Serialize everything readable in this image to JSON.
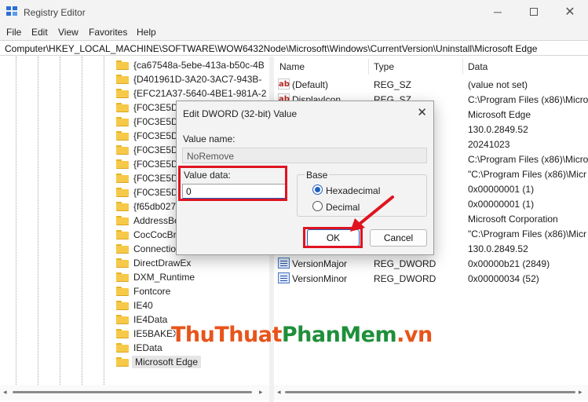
{
  "window": {
    "title": "Registry Editor",
    "minimize_icon": "minimize-icon",
    "maximize_icon": "maximize-icon",
    "close_icon": "close-icon"
  },
  "menu": [
    "File",
    "Edit",
    "View",
    "Favorites",
    "Help"
  ],
  "address": "Computer\\HKEY_LOCAL_MACHINE\\SOFTWARE\\WOW6432Node\\Microsoft\\Windows\\CurrentVersion\\Uninstall\\Microsoft Edge",
  "tree": {
    "items": [
      "{ca67548a-5ebe-413a-b50c-4B",
      "{D401961D-3A20-3AC7-943B-",
      "{EFC21A37-5640-4BE1-981A-2",
      "{F0C3E5D1",
      "{F0C3E5D1",
      "{F0C3E5D1",
      "{F0C3E5D1",
      "{F0C3E5D1",
      "{F0C3E5D1",
      "{F0C3E5D1",
      "{f65db027",
      "AddressBo",
      "CocCocBr",
      "Connection Manager",
      "DirectDrawEx",
      "DXM_Runtime",
      "Fontcore",
      "IE40",
      "IE4Data",
      "IE5BAKEX",
      "IEData",
      "Microsoft Edge"
    ],
    "selected": "Microsoft Edge"
  },
  "list": {
    "columns": [
      "Name",
      "Type",
      "Data"
    ],
    "rows": [
      {
        "name": "(Default)",
        "type": "REG_SZ",
        "data": "(value not set)",
        "icon": "string-value-icon"
      },
      {
        "name": "DisplayIcon",
        "type": "REG_SZ",
        "data": "C:\\Program Files (x86)\\Micro",
        "icon": "string-value-icon"
      },
      {
        "name": "",
        "type": "",
        "data": "Microsoft Edge",
        "icon": ""
      },
      {
        "name": "",
        "type": "",
        "data": "130.0.2849.52",
        "icon": ""
      },
      {
        "name": "",
        "type": "",
        "data": "20241023",
        "icon": ""
      },
      {
        "name": "",
        "type": "",
        "data": "C:\\Program Files (x86)\\Micro",
        "icon": ""
      },
      {
        "name": "",
        "type": "",
        "data": "\"C:\\Program Files (x86)\\Micr",
        "icon": ""
      },
      {
        "name": "",
        "type": "",
        "data": "0x00000001 (1)",
        "icon": ""
      },
      {
        "name": "",
        "type": "",
        "data": "0x00000001 (1)",
        "icon": ""
      },
      {
        "name": "",
        "type": "",
        "data": "Microsoft Corporation",
        "icon": ""
      },
      {
        "name": "",
        "type": "",
        "data": "\"C:\\Program Files (x86)\\Micr",
        "icon": ""
      },
      {
        "name": "",
        "type": "",
        "data": "130.0.2849.52",
        "icon": ""
      },
      {
        "name": "VersionMajor",
        "type": "REG_DWORD",
        "data": "0x00000b21 (2849)",
        "icon": "dword-value-icon"
      },
      {
        "name": "VersionMinor",
        "type": "REG_DWORD",
        "data": "0x00000034 (52)",
        "icon": "dword-value-icon"
      }
    ]
  },
  "dialog": {
    "title": "Edit DWORD (32-bit) Value",
    "value_name_label": "Value name:",
    "value_name": "NoRemove",
    "value_data_label": "Value data:",
    "value_data": "0",
    "base_label": "Base",
    "base_options": [
      "Hexadecimal",
      "Decimal"
    ],
    "base_selected": "Hexadecimal",
    "ok_label": "OK",
    "cancel_label": "Cancel"
  },
  "watermark": {
    "part1": "ThuThuat",
    "part2": "PhanMem",
    "part3": ".vn"
  },
  "colors": {
    "highlight_box": "#e0141f",
    "accent": "#1f5fbf",
    "watermark_orange": "#e8541a",
    "watermark_green": "#1f8f3a"
  }
}
